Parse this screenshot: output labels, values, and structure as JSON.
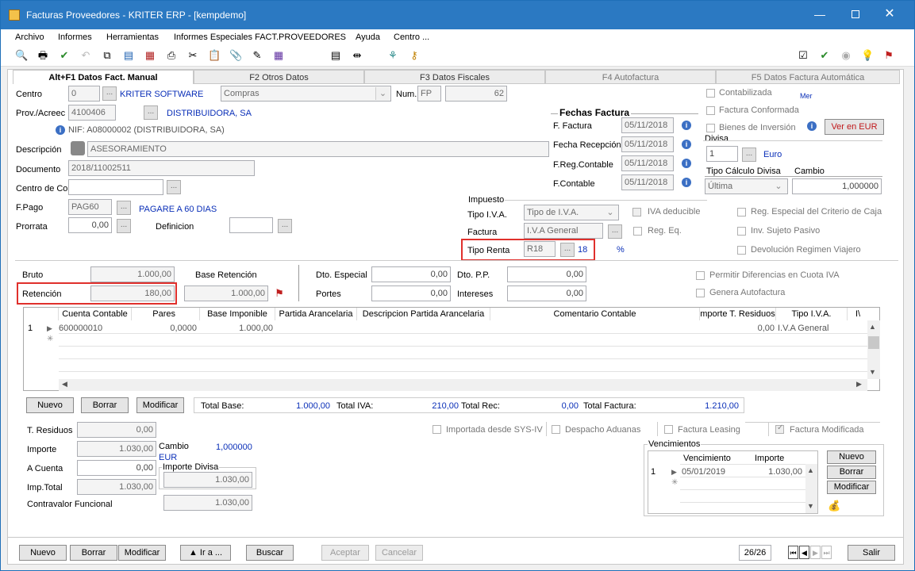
{
  "window": {
    "title": "Facturas Proveedores  - KRITER ERP - [kempdemo]"
  },
  "menu": [
    "Archivo",
    "Informes",
    "Herramientas",
    "Informes Especiales FACT.PROVEEDORES",
    "Ayuda",
    "Centro ..."
  ],
  "tabs": [
    "Alt+F1 Datos Fact. Manual",
    "F2 Otros Datos",
    "F3 Datos Fiscales",
    "F4 Autofactura",
    "F5 Datos Factura Automática"
  ],
  "header": {
    "centro_label": "Centro",
    "centro_value": "0",
    "centro_name": "KRITER SOFTWARE",
    "compras": "Compras",
    "num_label": "Num.",
    "num_series": "FP",
    "num_value": "62",
    "prov_label": "Prov./Acreec",
    "prov_value": "4100406",
    "prov_name": "DISTRIBUIDORA, SA",
    "nif": "NIF:  A08000002 (DISTRIBUIDORA, SA)",
    "descripcion_label": "Descripción",
    "descripcion_value": "ASESORAMIENTO",
    "documento_label": "Documento",
    "documento_value": "2018/11002511",
    "centro_co_label": "Centro de Co",
    "fpago_label": "F.Pago",
    "fpago_value": "PAG60",
    "fpago_name": "PAGARE A 60 DIAS",
    "prorrata_label": "Prorrata",
    "prorrata_value": "0,00",
    "definicion_label": "Definicion"
  },
  "fechas": {
    "title": "Fechas Factura",
    "rows": [
      {
        "label": "F. Factura",
        "value": "05/11/2018"
      },
      {
        "label": "Fecha Recepción",
        "value": "05/11/2018"
      },
      {
        "label": "F.Reg.Contable",
        "value": "05/11/2018"
      },
      {
        "label": "F.Contable",
        "value": "05/11/2018"
      }
    ]
  },
  "right": {
    "contabilizada": "Contabilizada",
    "conformada": "Factura Conformada",
    "bienes": "Bienes de Inversión",
    "mer": "Mer",
    "ver_eur": "Ver en EUR",
    "divisa_label": "Divisa",
    "divisa_value": "1",
    "divisa_name": "Euro",
    "tipo_calc_label": "Tipo Cálculo Divisa",
    "tipo_calc_value": "Última",
    "cambio_label": "Cambio",
    "cambio_value": "1,000000"
  },
  "impuesto": {
    "title": "Impuesto",
    "tipo_iva_label": "Tipo I.V.A.",
    "tipo_iva_value": "Tipo de I.V.A.",
    "iva_deducible": "IVA deducible",
    "factura_label": "Factura",
    "factura_value": "I.V.A General",
    "reg_eq": "Reg. Eq.",
    "tipo_renta_label": "Tipo Renta",
    "tipo_renta_value": "R18",
    "tipo_renta_pct": "18",
    "pct_sign": "%",
    "reg_especial": "Reg. Especial del Criterio de Caja",
    "inv_sujeto": "Inv. Sujeto Pasivo",
    "devolucion": "Devolución Regimen Viajero"
  },
  "totals": {
    "bruto_label": "Bruto",
    "bruto_value": "1.000,00",
    "base_ret_label": "Base Retención",
    "retencion_label": "Retención",
    "retencion_value": "180,00",
    "base_ret_value": "1.000,00",
    "dto_especial_label": "Dto. Especial",
    "dto_especial_value": "0,00",
    "dto_pp_label": "Dto. P.P.",
    "dto_pp_value": "0,00",
    "portes_label": "Portes",
    "portes_value": "0,00",
    "intereses_label": "Intereses",
    "intereses_value": "0,00",
    "permitir": "Permitir Diferencias en Cuota IVA",
    "genera_auto": "Genera Autofactura"
  },
  "grid": {
    "headers": [
      "Cuenta Contable",
      "Pares",
      "Base Imponible",
      "Partida Arancelaria",
      "Descripcion Partida Arancelaria",
      "Comentario Contable",
      "mporte T. Residuos",
      "Tipo I.V.A.",
      "I\\"
    ],
    "rows": [
      {
        "n": "1",
        "cuenta": "600000010",
        "pares": "0,0000",
        "base": "1.000,00",
        "residuos": "0,00",
        "tipo": "I.V.A General"
      }
    ]
  },
  "grid_buttons": {
    "nuevo": "Nuevo",
    "borrar": "Borrar",
    "modificar": "Modificar"
  },
  "summary": {
    "total_base_label": "Total Base:",
    "total_base": "1.000,00",
    "total_iva_label": "Total IVA:",
    "total_iva": "210,00",
    "total_rec_label": "Total Rec:",
    "total_rec": "0,00",
    "total_factura_label": "Total Factura:",
    "total_factura": "1.210,00"
  },
  "bottom": {
    "t_residuos_label": "T. Residuos",
    "t_residuos": "0,00",
    "importe_label": "Importe",
    "importe": "1.030,00",
    "a_cuenta_label": "A Cuenta",
    "a_cuenta": "0,00",
    "imp_total_label": "Imp.Total",
    "imp_total": "1.030,00",
    "contravalor_label": "Contravalor Funcional",
    "contravalor": "1.030,00",
    "cambio_label": "Cambio",
    "cambio_value": "1,000000",
    "eur": "EUR",
    "importe_divisa_label": "Importe Divisa",
    "importe_divisa": "1.030,00",
    "importada": "Importada desde SYS-IV",
    "despacho": "Despacho Aduanas",
    "leasing": "Factura Leasing",
    "modificada": "Factura Modificada"
  },
  "vencimientos": {
    "title": "Vencimientos",
    "col_venc": "Vencimiento",
    "col_imp": "Importe",
    "row_n": "1",
    "row_venc": "05/01/2019",
    "row_imp": "1.030,00",
    "nuevo": "Nuevo",
    "borrar": "Borrar",
    "modificar": "Modificar"
  },
  "footer": {
    "nuevo": "Nuevo",
    "borrar": "Borrar",
    "modificar": "Modificar",
    "ira": "▲ Ir a ...",
    "buscar": "Buscar",
    "aceptar": "Aceptar",
    "cancelar": "Cancelar",
    "record": "26/26",
    "salir": "Salir"
  }
}
